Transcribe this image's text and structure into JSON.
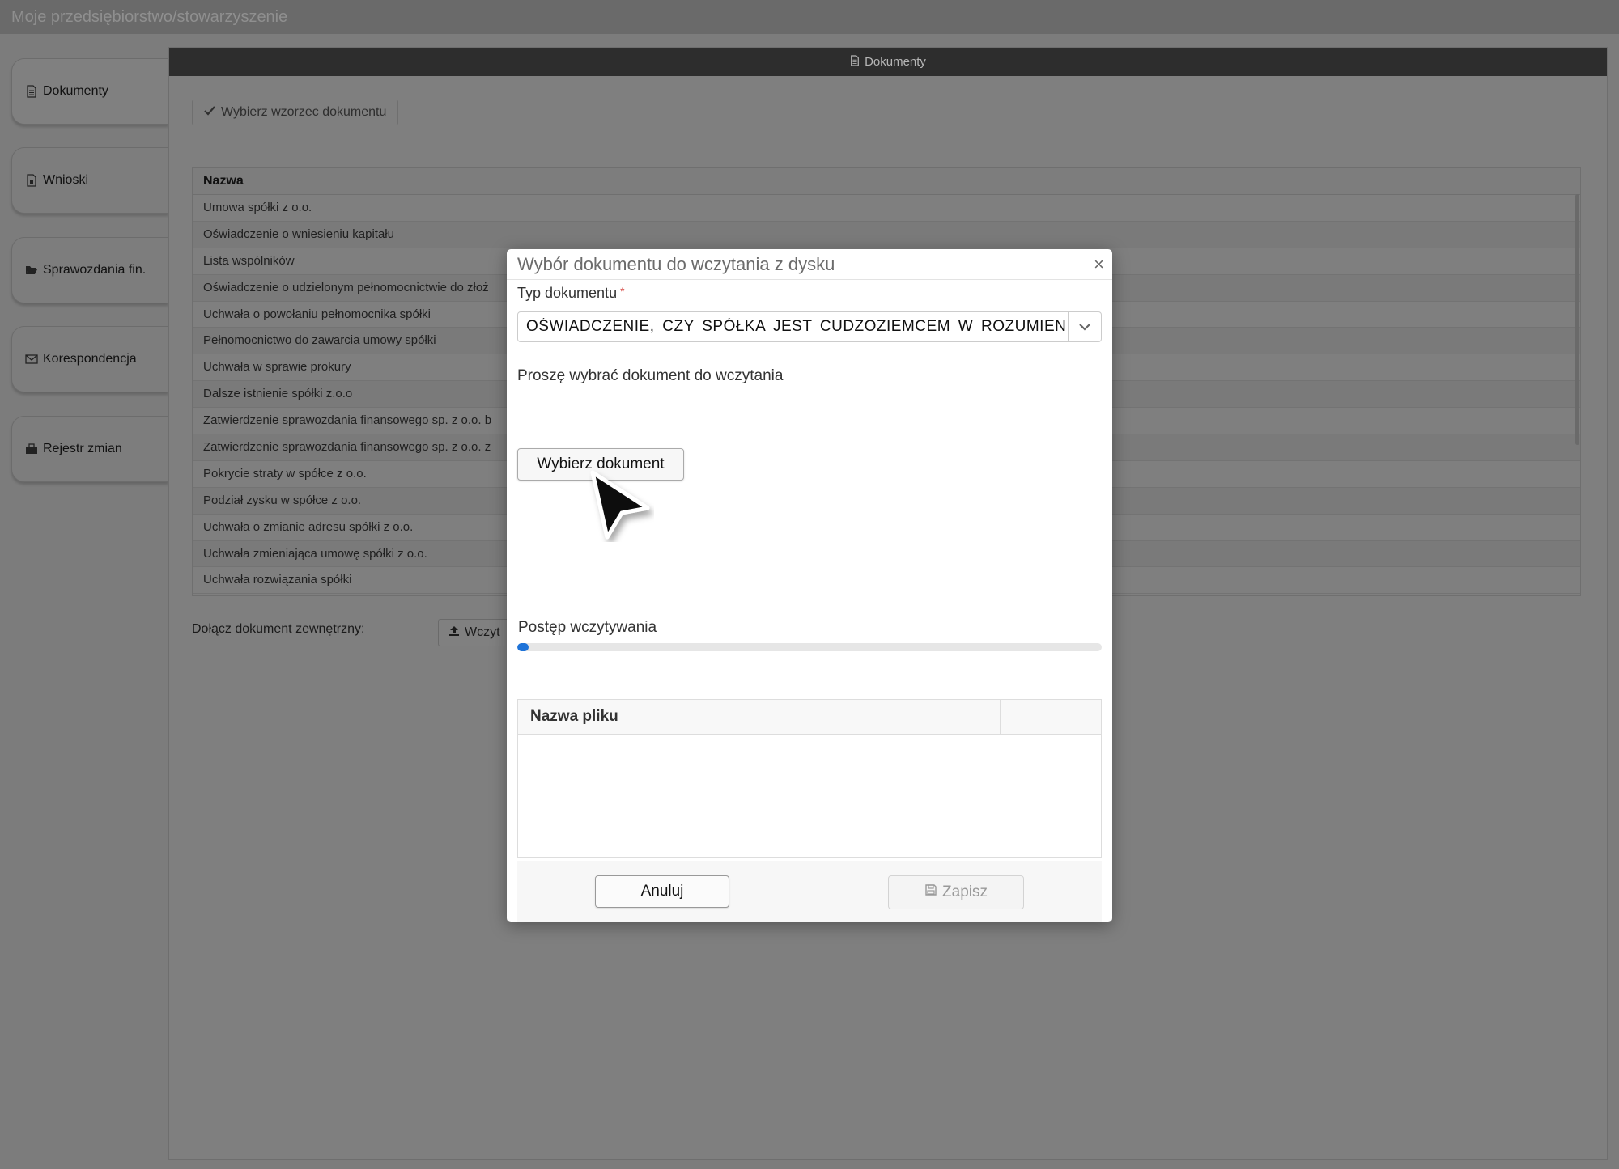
{
  "app": {
    "title": "Moje przedsiębiorstwo/stowarzyszenie"
  },
  "sidebar": {
    "items": [
      {
        "label": "Dokumenty",
        "icon": "document-icon"
      },
      {
        "label": "Wnioski",
        "icon": "document-lock-icon"
      },
      {
        "label": "Sprawozdania fin.",
        "icon": "folder-open-icon"
      },
      {
        "label": "Korespondencja",
        "icon": "envelope-icon"
      },
      {
        "label": "Rejestr zmian",
        "icon": "briefcase-icon"
      }
    ]
  },
  "panel": {
    "title": "Dokumenty",
    "choose_template_label": "Wybierz wzorzec dokumentu",
    "table": {
      "header": "Nazwa",
      "rows": [
        "Umowa spółki z o.o.",
        "Oświadczenie o wniesieniu kapitału",
        "Lista wspólników",
        "Oświadczenie o udzielonym pełnomocnictwie do złoż",
        "Uchwała o powołaniu pełnomocnika spółki",
        "Pełnomocnictwo do zawarcia umowy spółki",
        "Uchwała w sprawie prokury",
        "Dalsze istnienie spółki z.o.o",
        "Zatwierdzenie sprawozdania finansowego sp. z o.o. b",
        "Zatwierdzenie sprawozdania finansowego sp. z o.o. z",
        "Pokrycie straty w spółce z o.o.",
        "Podział zysku w spółce z o.o.",
        "Uchwała o zmianie adresu spółki z o.o.",
        "Uchwała zmieniająca umowę spółki z o.o.",
        "Uchwała rozwiązania spółki"
      ]
    },
    "attach_label": "Dołącz dokument zewnętrzny:",
    "attach_button": "Wczyt"
  },
  "modal": {
    "title": "Wybór dokumentu do wczytania z dysku",
    "close": "×",
    "doc_type_label": "Typ dokumentu",
    "required_mark": "*",
    "doc_type_value": "OŚWIADCZENIE, CZY SPÓŁKA JEST CUDZOZIEMCEM W ROZUMIENIU",
    "prompt": "Proszę wybrać dokument do wczytania",
    "pick_button": "Wybierz dokument",
    "progress_label": "Postęp wczytywania",
    "progress_value": 0.02,
    "file_table_header": "Nazwa pliku",
    "cancel_button": "Anuluj",
    "save_button": "Zapisz"
  },
  "colors": {
    "accent": "#1e73d8",
    "required": "#d9534f"
  }
}
